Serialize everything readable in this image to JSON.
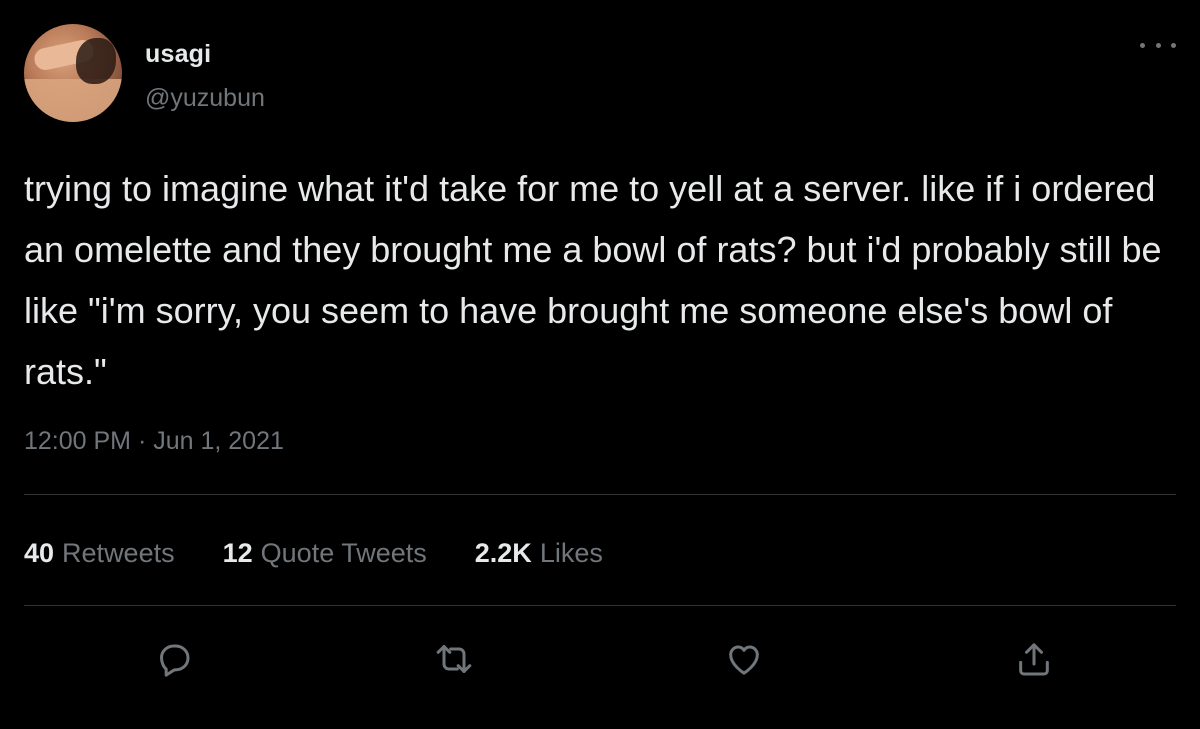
{
  "author": {
    "display_name": "usagi",
    "handle": "@yuzubun",
    "avatar_icon": "profile-photo"
  },
  "tweet": {
    "text": "trying to imagine what it'd take for me to yell at a server. like if i ordered an omelette and they brought me a bowl of rats? but i'd probably still be like \"i'm sorry, you seem to have brought me someone else's bowl of rats.\"",
    "timestamp": "12:00 PM · Jun 1, 2021"
  },
  "stats": {
    "retweets": {
      "count": "40",
      "label": "Retweets"
    },
    "quote_tweets": {
      "count": "12",
      "label": "Quote Tweets"
    },
    "likes": {
      "count": "2.2K",
      "label": "Likes"
    }
  },
  "actions": {
    "reply_icon": "reply-icon",
    "retweet_icon": "retweet-icon",
    "like_icon": "heart-icon",
    "share_icon": "share-icon"
  },
  "colors": {
    "background": "#000000",
    "primary_text": "#e7e9ea",
    "secondary_text": "#71767b",
    "divider": "#2f3336"
  }
}
